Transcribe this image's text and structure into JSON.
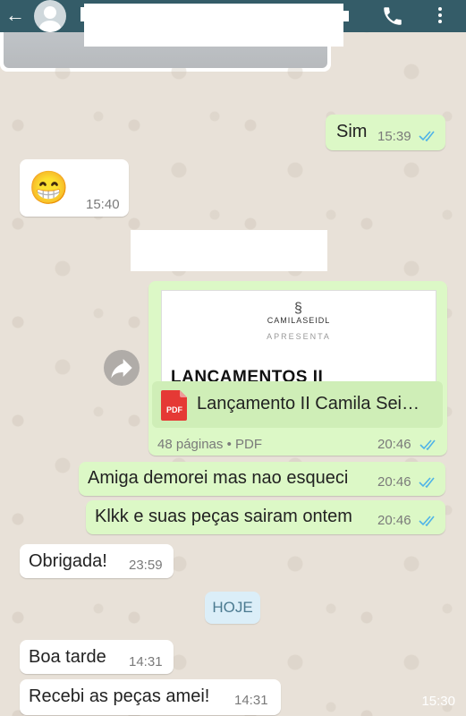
{
  "header": {
    "back_icon": "arrow-left-icon",
    "avatar_icon": "default-avatar-icon",
    "call_icon": "phone-icon",
    "menu_icon": "more-vert-icon"
  },
  "messages": {
    "image_time": "15:30",
    "sim": {
      "text": "Sim",
      "time": "15:39"
    },
    "emoji": {
      "text": "😁",
      "time": "15:40"
    },
    "document": {
      "brand": "CAMILASEIDL",
      "presents": "APRESENTA",
      "heading": "LANÇAMENTOS II",
      "file_name": "Lançamento II Camila Sei…",
      "file_type_badge": "PDF",
      "meta": "48 páginas • PDF",
      "time": "20:46"
    },
    "amiga": {
      "text": "Amiga demorei mas nao esqueci",
      "time": "20:46"
    },
    "klkk": {
      "text": "Klkk e suas peças sairam ontem",
      "time": "20:46"
    },
    "obrigada": {
      "text": "Obrigada!",
      "time": "23:59"
    },
    "day_divider": "HOJE",
    "boa_tarde": {
      "text": "Boa tarde",
      "time": "14:31"
    },
    "recebi": {
      "text": "Recebi as peças amei!",
      "time": "14:31"
    }
  },
  "colors": {
    "header_bg": "#345c68",
    "outgoing_bubble": "#dcf8c6",
    "incoming_bubble": "#ffffff",
    "read_ticks": "#4fb3e8",
    "chat_bg": "#e8e1d8"
  }
}
